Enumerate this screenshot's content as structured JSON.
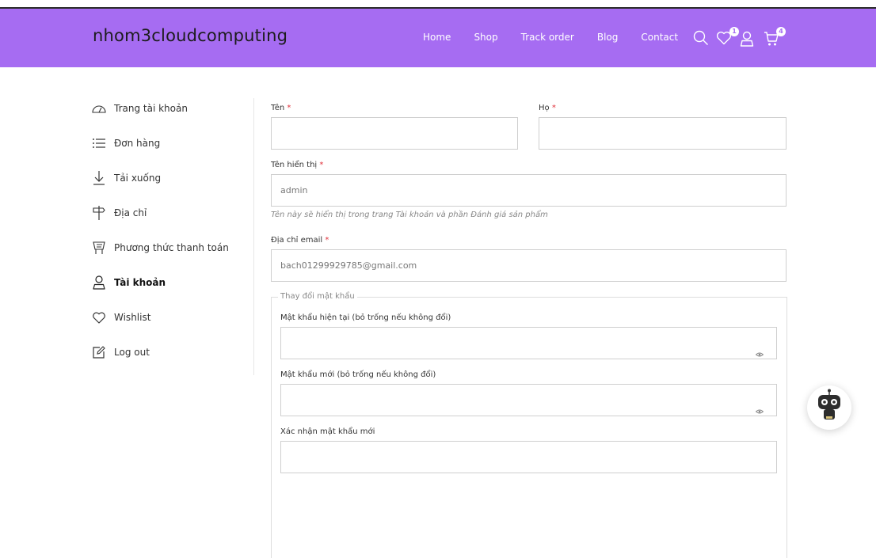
{
  "header": {
    "logo": "nhom3cloudcomputing",
    "nav": [
      "Home",
      "Shop",
      "Track order",
      "Blog",
      "Contact"
    ],
    "icons": [
      "search-icon",
      "heart-icon",
      "user-icon",
      "cart-icon"
    ],
    "wishlist_count": "1",
    "cart_count": "4",
    "bg_color": "#a66cf2"
  },
  "sidebar": {
    "items": [
      {
        "label": "Trang tài khoản",
        "icon": "dashboard-icon"
      },
      {
        "label": "Đơn hàng",
        "icon": "list-icon"
      },
      {
        "label": "Tải xuống",
        "icon": "download-icon"
      },
      {
        "label": "Địa chỉ",
        "icon": "signpost-icon"
      },
      {
        "label": "Phương thức thanh toán",
        "icon": "cart-payment-icon"
      },
      {
        "label": "Tài khoản",
        "icon": "user-icon",
        "active": true
      },
      {
        "label": "Wishlist",
        "icon": "heart-icon"
      },
      {
        "label": "Log out",
        "icon": "edit-icon"
      }
    ]
  },
  "form": {
    "first_name_label": "Tên",
    "last_name_label": "Họ",
    "required_mark": "*",
    "display_name_label": "Tên hiển thị",
    "display_name_value": "admin",
    "display_name_hint": "Tên này sẽ hiển thị trong trang Tài khoản và phần Đánh giá sản phẩm",
    "email_label": "Địa chỉ email",
    "email_value": "bach01299929785@gmail.com",
    "password_legend": "Thay đổi mật khẩu",
    "current_password_label": "Mật khẩu hiện tại (bỏ trống nếu không đổi)",
    "new_password_label": "Mật khẩu mới (bỏ trống nếu không đổi)",
    "confirm_password_label": "Xác nhận mật khẩu mới"
  }
}
